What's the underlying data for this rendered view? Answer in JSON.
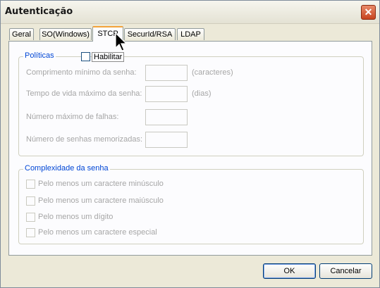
{
  "window": {
    "title": "Autenticação"
  },
  "tabs": [
    {
      "label": "Geral"
    },
    {
      "label": "SO(Windows)"
    },
    {
      "label": "STCP",
      "active": true
    },
    {
      "label": "SecurId/RSA"
    },
    {
      "label": "LDAP"
    }
  ],
  "policies": {
    "title": "Políticas",
    "enable_label": "Habilitar",
    "enable_checked": false,
    "fields": [
      {
        "label": "Comprimento mínimo da senha:",
        "value": "",
        "unit": "(caracteres)"
      },
      {
        "label": "Tempo de vida máximo da senha:",
        "value": "",
        "unit": "(dias)"
      },
      {
        "label": "Número máximo de falhas:",
        "value": "",
        "unit": ""
      },
      {
        "label": "Número de senhas memorizadas:",
        "value": "",
        "unit": ""
      }
    ]
  },
  "complexity": {
    "title": "Complexidade da senha",
    "options": [
      {
        "label": "Pelo menos um caractere minúsculo",
        "checked": false
      },
      {
        "label": "Pelo menos um caractere maiúsculo",
        "checked": false
      },
      {
        "label": "Pelo menos um dígito",
        "checked": false
      },
      {
        "label": "Pelo menos um caractere especial",
        "checked": false
      }
    ]
  },
  "buttons": {
    "ok": "OK",
    "cancel": "Cancelar"
  },
  "colors": {
    "group_title": "#0046d5",
    "disabled_text": "#a6a6a6",
    "active_tab_accent": "#f3a33a"
  },
  "icons": {
    "close": "close-icon",
    "cursor": "mouse-pointer-icon"
  }
}
